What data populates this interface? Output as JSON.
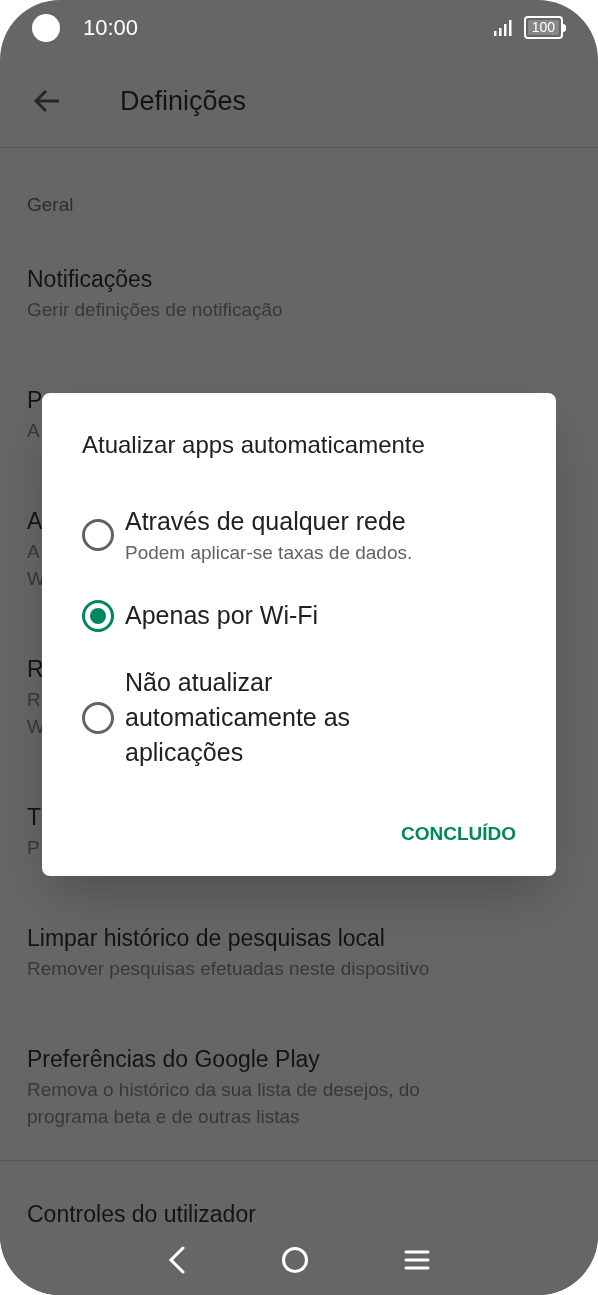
{
  "status_bar": {
    "time": "10:00",
    "battery": "100"
  },
  "app_bar": {
    "title": "Definições"
  },
  "settings": {
    "section": "Geral",
    "items": [
      {
        "title": "Notificações",
        "subtitle": [
          "Gerir definições de notificação"
        ]
      },
      {
        "title": "P",
        "subtitle": [
          "A"
        ]
      },
      {
        "title": "A",
        "subtitle": [
          "A",
          "W"
        ]
      },
      {
        "title": "R",
        "subtitle": [
          "R",
          "W"
        ]
      },
      {
        "title": "T",
        "subtitle": [
          "P"
        ]
      },
      {
        "title": "Limpar histórico de pesquisas local",
        "subtitle": [
          "Remover pesquisas efetuadas neste dispositivo"
        ]
      },
      {
        "title": "Preferências do Google Play",
        "subtitle": [
          "Remova o histórico da sua lista de desejos, do",
          "programa beta e de outras listas"
        ]
      }
    ],
    "next_section": "Controles do utilizador"
  },
  "dialog": {
    "title": "Atualizar apps automaticamente",
    "options": [
      {
        "label": [
          "Através de qualquer rede"
        ],
        "hint": "Podem aplicar-se taxas de dados.",
        "selected": false
      },
      {
        "label": [
          "Apenas por Wi-Fi"
        ],
        "selected": true
      },
      {
        "label": [
          "Não atualizar",
          "automaticamente as",
          "aplicações"
        ],
        "selected": false
      }
    ],
    "button": "CONCLUÍDO"
  }
}
